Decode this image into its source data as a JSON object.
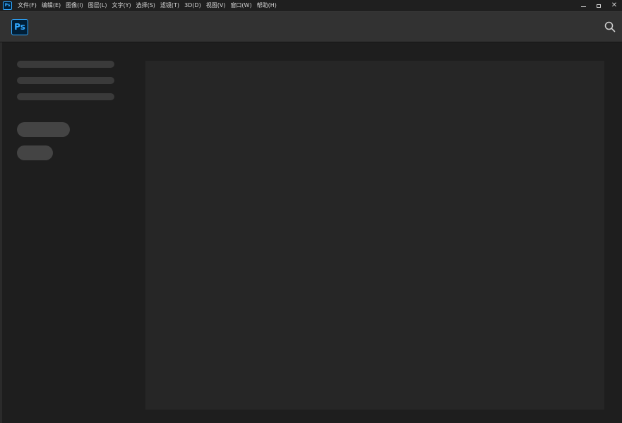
{
  "menubar": {
    "app_icon": "Ps",
    "items": [
      {
        "label": "文件(F)"
      },
      {
        "label": "编辑(E)"
      },
      {
        "label": "图像(I)"
      },
      {
        "label": "图层(L)"
      },
      {
        "label": "文字(Y)"
      },
      {
        "label": "选择(S)"
      },
      {
        "label": "滤镜(T)"
      },
      {
        "label": "3D(D)"
      },
      {
        "label": "视图(V)"
      },
      {
        "label": "窗口(W)"
      },
      {
        "label": "帮助(H)"
      }
    ]
  },
  "window_controls": {
    "minimize_icon": "minimize-icon",
    "maximize_icon": "maximize-icon",
    "close_label": "✕"
  },
  "header": {
    "logo_text": "Ps",
    "search_icon": "search-icon"
  },
  "colors": {
    "brand_blue": "#31a8ff",
    "brand_dark": "#001e36",
    "background": "#1e1e1e",
    "header": "#323232",
    "panel": "#262626",
    "skeleton": "#3a3a3a"
  }
}
